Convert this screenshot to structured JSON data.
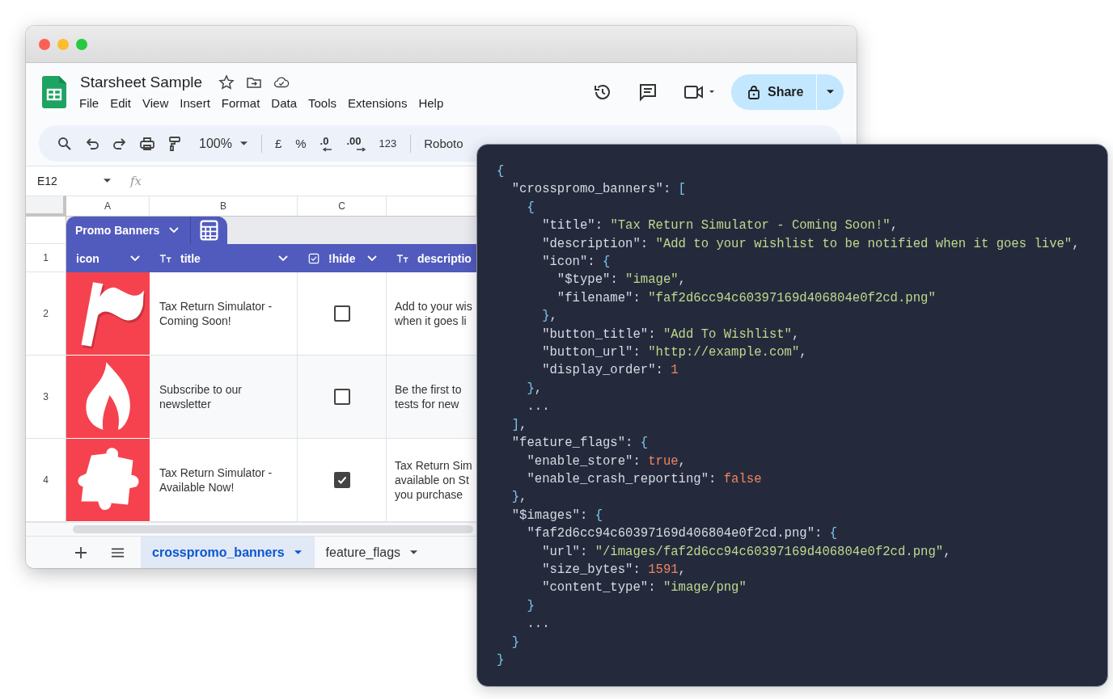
{
  "sheet_window": {
    "document_title": "Starsheet Sample",
    "menu": [
      "File",
      "Edit",
      "View",
      "Insert",
      "Format",
      "Data",
      "Tools",
      "Extensions",
      "Help"
    ],
    "share_button": "Share",
    "toolbar": {
      "zoom": "100%",
      "currency": "£",
      "percent": "%",
      "decrease_decimals": ".0",
      "increase_decimals": ".00",
      "number_format": "123",
      "font": "Roboto"
    },
    "name_box": "E12",
    "formula_label": "fx",
    "columns": [
      "A",
      "B",
      "C"
    ],
    "table_name": "Promo Banners",
    "fields": [
      {
        "label": "icon"
      },
      {
        "kind": "text",
        "label": "title"
      },
      {
        "kind": "checkbox",
        "label": "!hide"
      },
      {
        "kind": "text",
        "label": "descriptio"
      }
    ],
    "rows": [
      {
        "number": "2",
        "icon": {
          "kind": "picture"
        },
        "title": "Tax Return Simulator - Coming Soon!",
        "hide": false,
        "description": [
          "Add to your wis",
          "when it goes li"
        ]
      },
      {
        "number": "3",
        "icon": {
          "kind": "picture"
        },
        "title": "Subscribe to our newsletter",
        "hide": false,
        "description": [
          "Be the first to",
          "tests for new"
        ]
      },
      {
        "number": "4",
        "icon": {
          "kind": "picture"
        },
        "title": "Tax Return Simulator - Available Now!",
        "hide": true,
        "description": [
          "Tax Return Sim",
          "available on St",
          "you purchase"
        ]
      }
    ],
    "header_row_number": "1",
    "sheet_tabs": [
      {
        "label": "crosspromo_banners",
        "selected": true
      },
      {
        "label": "feature_flags",
        "selected": false
      }
    ]
  },
  "code_panel": {
    "lines": [
      [
        {
          "kind": "brace",
          "text": "{"
        }
      ],
      [
        {
          "kind": "key",
          "text": "  \"crosspromo_banners\""
        },
        {
          "kind": "punct",
          "text": ": "
        },
        {
          "kind": "brace",
          "text": "["
        }
      ],
      [
        {
          "kind": "brace",
          "text": "    {"
        }
      ],
      [
        {
          "kind": "key",
          "text": "      \"title\""
        },
        {
          "kind": "punct",
          "text": ": "
        },
        {
          "kind": "string",
          "text": "\"Tax Return Simulator - Coming Soon!\""
        },
        {
          "kind": "punct",
          "text": ","
        }
      ],
      [
        {
          "kind": "key",
          "text": "      \"description\""
        },
        {
          "kind": "punct",
          "text": ": "
        },
        {
          "kind": "string",
          "text": "\"Add to your wishlist to be notified when it goes live\""
        },
        {
          "kind": "punct",
          "text": ","
        }
      ],
      [
        {
          "kind": "key",
          "text": "      \"icon\""
        },
        {
          "kind": "punct",
          "text": ": "
        },
        {
          "kind": "brace",
          "text": "{"
        }
      ],
      [
        {
          "kind": "key",
          "text": "        \"$type\""
        },
        {
          "kind": "punct",
          "text": ": "
        },
        {
          "kind": "string",
          "text": "\"image\""
        },
        {
          "kind": "punct",
          "text": ","
        }
      ],
      [
        {
          "kind": "key",
          "text": "        \"filename\""
        },
        {
          "kind": "punct",
          "text": ": "
        },
        {
          "kind": "string",
          "text": "\"faf2d6cc94c60397169d406804e0f2cd.png\""
        }
      ],
      [
        {
          "kind": "brace",
          "text": "      }"
        },
        {
          "kind": "punct",
          "text": ","
        }
      ],
      [
        {
          "kind": "key",
          "text": "      \"button_title\""
        },
        {
          "kind": "punct",
          "text": ": "
        },
        {
          "kind": "string",
          "text": "\"Add To Wishlist\""
        },
        {
          "kind": "punct",
          "text": ","
        }
      ],
      [
        {
          "kind": "key",
          "text": "      \"button_url\""
        },
        {
          "kind": "punct",
          "text": ": "
        },
        {
          "kind": "string",
          "text": "\"http://example.com\""
        },
        {
          "kind": "punct",
          "text": ","
        }
      ],
      [
        {
          "kind": "key",
          "text": "      \"display_order\""
        },
        {
          "kind": "punct",
          "text": ": "
        },
        {
          "kind": "literal",
          "text": "1"
        }
      ],
      [
        {
          "kind": "brace",
          "text": "    }"
        },
        {
          "kind": "punct",
          "text": ","
        }
      ],
      [
        {
          "kind": "punct",
          "text": "    ..."
        }
      ],
      [
        {
          "kind": "brace",
          "text": "  ]"
        },
        {
          "kind": "punct",
          "text": ","
        }
      ],
      [
        {
          "kind": "key",
          "text": "  \"feature_flags\""
        },
        {
          "kind": "punct",
          "text": ": "
        },
        {
          "kind": "brace",
          "text": "{"
        }
      ],
      [
        {
          "kind": "key",
          "text": "    \"enable_store\""
        },
        {
          "kind": "punct",
          "text": ": "
        },
        {
          "kind": "literal",
          "text": "true"
        },
        {
          "kind": "punct",
          "text": ","
        }
      ],
      [
        {
          "kind": "key",
          "text": "    \"enable_crash_reporting\""
        },
        {
          "kind": "punct",
          "text": ": "
        },
        {
          "kind": "literal",
          "text": "false"
        }
      ],
      [
        {
          "kind": "brace",
          "text": "  }"
        },
        {
          "kind": "punct",
          "text": ","
        }
      ],
      [
        {
          "kind": "key",
          "text": "  \"$images\""
        },
        {
          "kind": "punct",
          "text": ": "
        },
        {
          "kind": "brace",
          "text": "{"
        }
      ],
      [
        {
          "kind": "key",
          "text": "    \"faf2d6cc94c60397169d406804e0f2cd.png\""
        },
        {
          "kind": "punct",
          "text": ": "
        },
        {
          "kind": "brace",
          "text": "{"
        }
      ],
      [
        {
          "kind": "key",
          "text": "      \"url\""
        },
        {
          "kind": "punct",
          "text": ": "
        },
        {
          "kind": "string",
          "text": "\"/images/faf2d6cc94c60397169d406804e0f2cd.png\""
        },
        {
          "kind": "punct",
          "text": ","
        }
      ],
      [
        {
          "kind": "key",
          "text": "      \"size_bytes\""
        },
        {
          "kind": "punct",
          "text": ": "
        },
        {
          "kind": "literal",
          "text": "1591"
        },
        {
          "kind": "punct",
          "text": ","
        }
      ],
      [
        {
          "kind": "key",
          "text": "      \"content_type\""
        },
        {
          "kind": "punct",
          "text": ": "
        },
        {
          "kind": "string",
          "text": "\"image/png\""
        }
      ],
      [
        {
          "kind": "brace",
          "text": "    }"
        }
      ],
      [
        {
          "kind": "punct",
          "text": "    ..."
        }
      ],
      [
        {
          "kind": "brace",
          "text": "  }"
        }
      ],
      [
        {
          "kind": "brace",
          "text": "}"
        }
      ]
    ]
  }
}
